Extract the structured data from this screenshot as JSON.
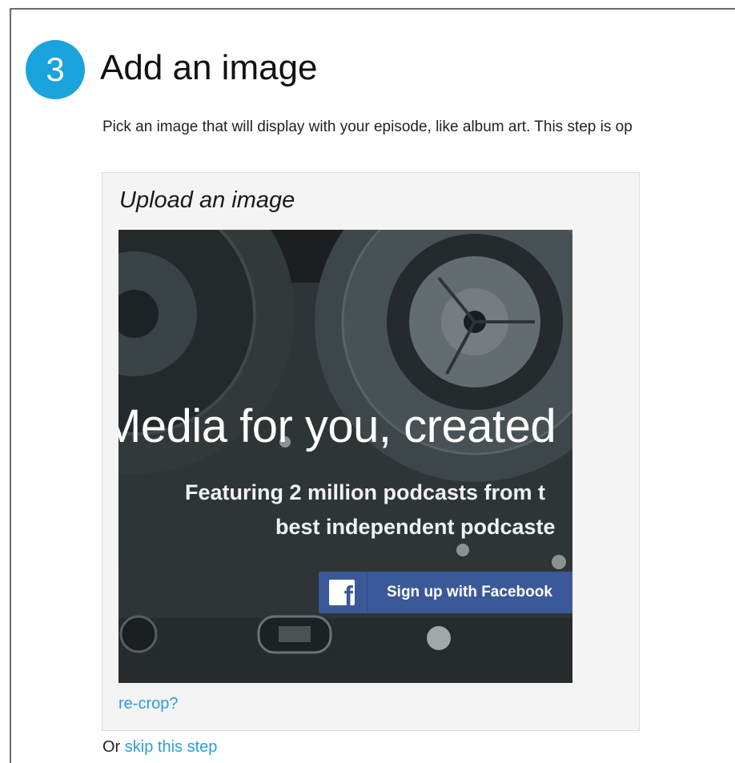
{
  "step": {
    "number": "3",
    "title": "Add an image",
    "description": "Pick an image that will display with your episode, like album art. This step is op"
  },
  "upload": {
    "heading": "Upload an image",
    "image_text": {
      "headline": "Media for you, created",
      "subtitle_line1": "Featuring 2 million podcasts from t",
      "subtitle_line2": "best independent podcaste",
      "facebook_button_label": "Sign up with Facebook"
    },
    "recrop_link": "re-crop?"
  },
  "skip": {
    "prefix": "Or",
    "link": "skip this step"
  },
  "colors": {
    "badge": "#1aa3dc",
    "link": "#2a9fd6",
    "facebook": "#3b5998",
    "panel_bg": "#f4f4f4"
  },
  "icons": [
    "facebook-icon"
  ]
}
